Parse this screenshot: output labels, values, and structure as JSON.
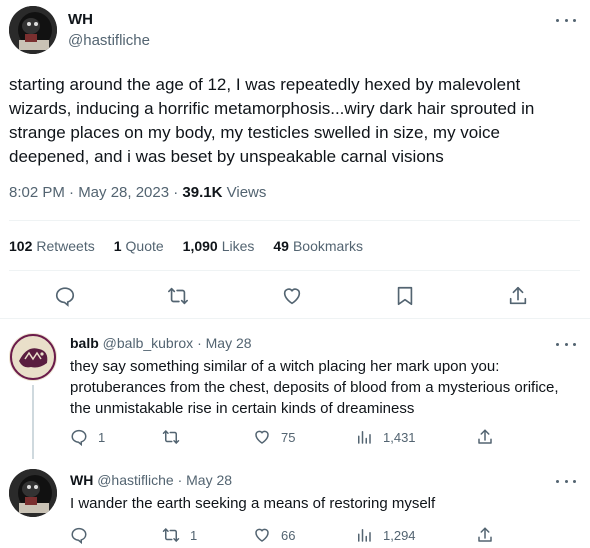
{
  "main_tweet": {
    "author_name": "WH",
    "author_handle": "@hastifliche",
    "text": "starting around the age of 12, I was repeatedly hexed by malevolent wizards, inducing a horrific metamorphosis...wiry dark hair sprouted in strange places on my body, my testicles swelled in size, my voice deepened, and i was beset by unspeakable carnal visions",
    "time": "8:02 PM · May 28, 2023 ·",
    "views_count": "39.1K",
    "views_label": "Views",
    "stats": {
      "retweets_count": "102",
      "retweets_label": "Retweets",
      "quotes_count": "1",
      "quotes_label": "Quote",
      "likes_count": "1,090",
      "likes_label": "Likes",
      "bookmarks_count": "49",
      "bookmarks_label": "Bookmarks"
    },
    "actions": [
      "reply-icon",
      "retweet-icon",
      "like-icon",
      "bookmark-icon",
      "share-icon"
    ]
  },
  "replies": [
    {
      "author_name": "balb",
      "author_handle": "@balb_kubrox",
      "date": "· May 28",
      "text": "they say something similar of a witch placing her mark upon you: protuberances from the chest, deposits of blood from a mysterious orifice, the unmistakable rise in certain kinds of dreaminess",
      "reply_count": "1",
      "retweet_count": "",
      "like_count": "75",
      "view_count": "1,431"
    },
    {
      "author_name": "WH",
      "author_handle": "@hastifliche",
      "date": "· May 28",
      "text": "I wander the earth seeking a means of restoring myself",
      "reply_count": "",
      "retweet_count": "1",
      "like_count": "66",
      "view_count": "1,294"
    }
  ],
  "colors": {
    "text": "#0f1419",
    "secondary": "#536471",
    "divider": "#eff3f4",
    "thread_line": "#cfd9de"
  }
}
